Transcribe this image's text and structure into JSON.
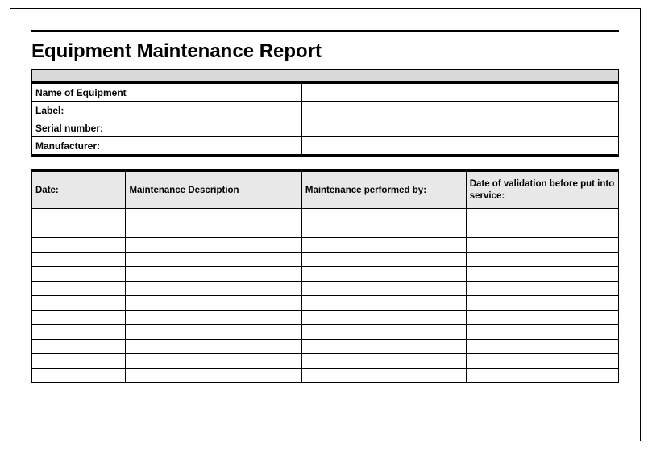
{
  "title": "Equipment Maintenance Report",
  "info_rows": [
    {
      "label": "Name of Equipment",
      "value": ""
    },
    {
      "label": "Label:",
      "value": ""
    },
    {
      "label": "Serial number:",
      "value": ""
    },
    {
      "label": "Manufacturer:",
      "value": ""
    }
  ],
  "columns": {
    "date": "Date:",
    "description": "Maintenance Description",
    "performed_by": "Maintenance performed by:",
    "validation": "Date of validation before put into service:"
  },
  "rows": [
    {
      "date": "",
      "description": "",
      "performed_by": "",
      "validation": ""
    },
    {
      "date": "",
      "description": "",
      "performed_by": "",
      "validation": ""
    },
    {
      "date": "",
      "description": "",
      "performed_by": "",
      "validation": ""
    },
    {
      "date": "",
      "description": "",
      "performed_by": "",
      "validation": ""
    },
    {
      "date": "",
      "description": "",
      "performed_by": "",
      "validation": ""
    },
    {
      "date": "",
      "description": "",
      "performed_by": "",
      "validation": ""
    },
    {
      "date": "",
      "description": "",
      "performed_by": "",
      "validation": ""
    },
    {
      "date": "",
      "description": "",
      "performed_by": "",
      "validation": ""
    },
    {
      "date": "",
      "description": "",
      "performed_by": "",
      "validation": ""
    },
    {
      "date": "",
      "description": "",
      "performed_by": "",
      "validation": ""
    },
    {
      "date": "",
      "description": "",
      "performed_by": "",
      "validation": ""
    },
    {
      "date": "",
      "description": "",
      "performed_by": "",
      "validation": ""
    }
  ]
}
